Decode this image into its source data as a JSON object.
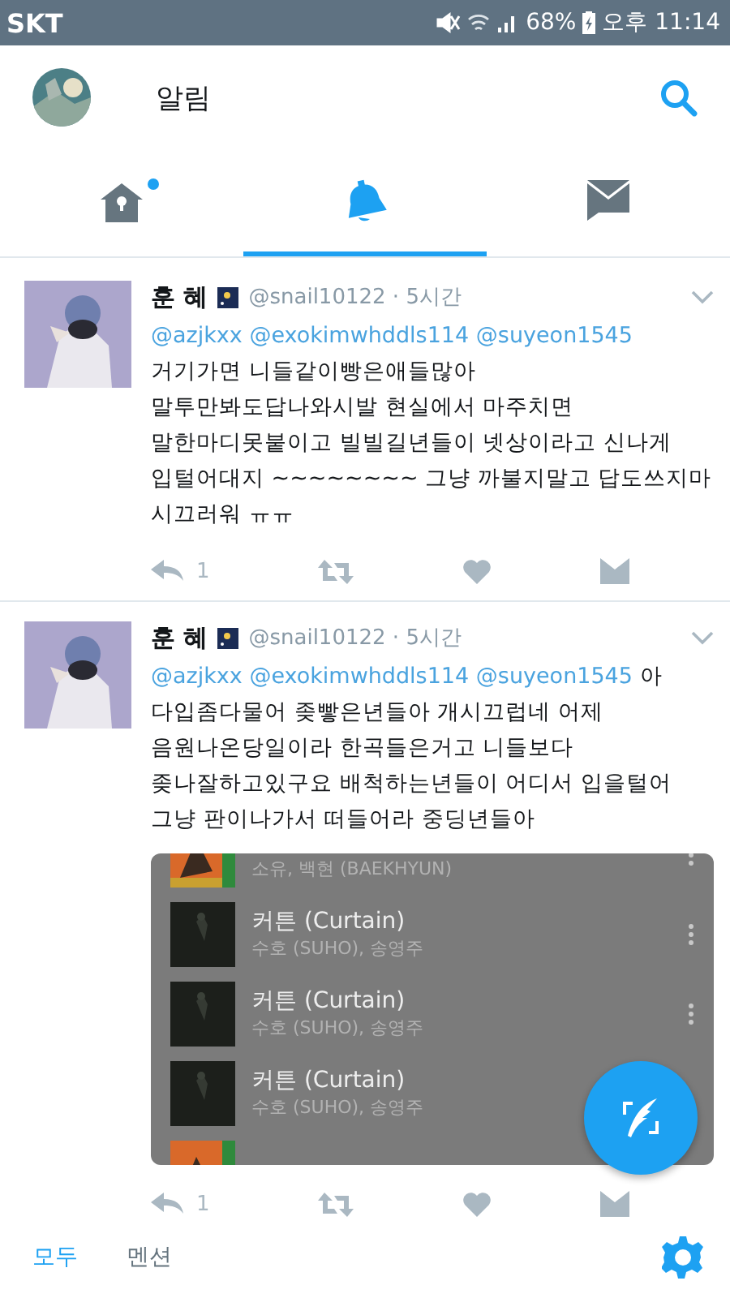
{
  "status_bar": {
    "carrier": "SKT",
    "battery": "68%",
    "time": "오후 11:14"
  },
  "header": {
    "title": "알림"
  },
  "tabs": [
    {
      "kind": "home",
      "selected": false,
      "badge": true
    },
    {
      "kind": "bell",
      "selected": true,
      "badge": false
    },
    {
      "kind": "mail",
      "selected": false,
      "badge": false
    }
  ],
  "tweets": [
    {
      "name": "훈 혜",
      "meta": "@snail10122 · 5시간",
      "mentions": [
        "@azjkxx",
        "@exokimwhddls114",
        "@suyeon1545"
      ],
      "text": "\n거기가면 니들같이빵은애들많아\n말투만봐도답나와시발 현실에서 마주치면\n말한마디못붙이고 빌빌길년들이 넷상이라고 신나게\n입털어대지 ~~~~~~~~ 그냥 까불지말고 답도쓰지마\n시끄러워 ㅠㅠ",
      "replies": "1"
    },
    {
      "name": "훈 혜",
      "meta": "@snail10122 · 5시간",
      "mentions": [
        "@azjkxx",
        "@exokimwhddls114",
        "@suyeon1545"
      ],
      "text": " 아\n다입좀다물어 좆빻은년들아 개시끄럽네 어제\n음원나온당일이라 한곡들은거고 니들보다\n좆나잘하고있구요 배척하는년들이 어디서 입을털어\n그냥 판이나가서 떠들어라 중딩년들아",
      "replies": "1",
      "embed": {
        "rows": [
          {
            "subtitle": "소유, 백현 (BAEKHYUN)",
            "menu": true
          },
          {
            "title": "커튼 (Curtain)",
            "subtitle": "수호 (SUHO), 송영주",
            "menu": true
          },
          {
            "title": "커튼 (Curtain)",
            "subtitle": "수호 (SUHO), 송영주",
            "menu": true
          },
          {
            "title": "커튼 (Curtain)",
            "subtitle": "수호 (SUHO), 송영주",
            "menu": false
          },
          {
            "menu": false
          }
        ]
      }
    }
  ],
  "filters": [
    {
      "label": "모두",
      "selected": true
    },
    {
      "label": "멘션",
      "selected": false
    }
  ]
}
